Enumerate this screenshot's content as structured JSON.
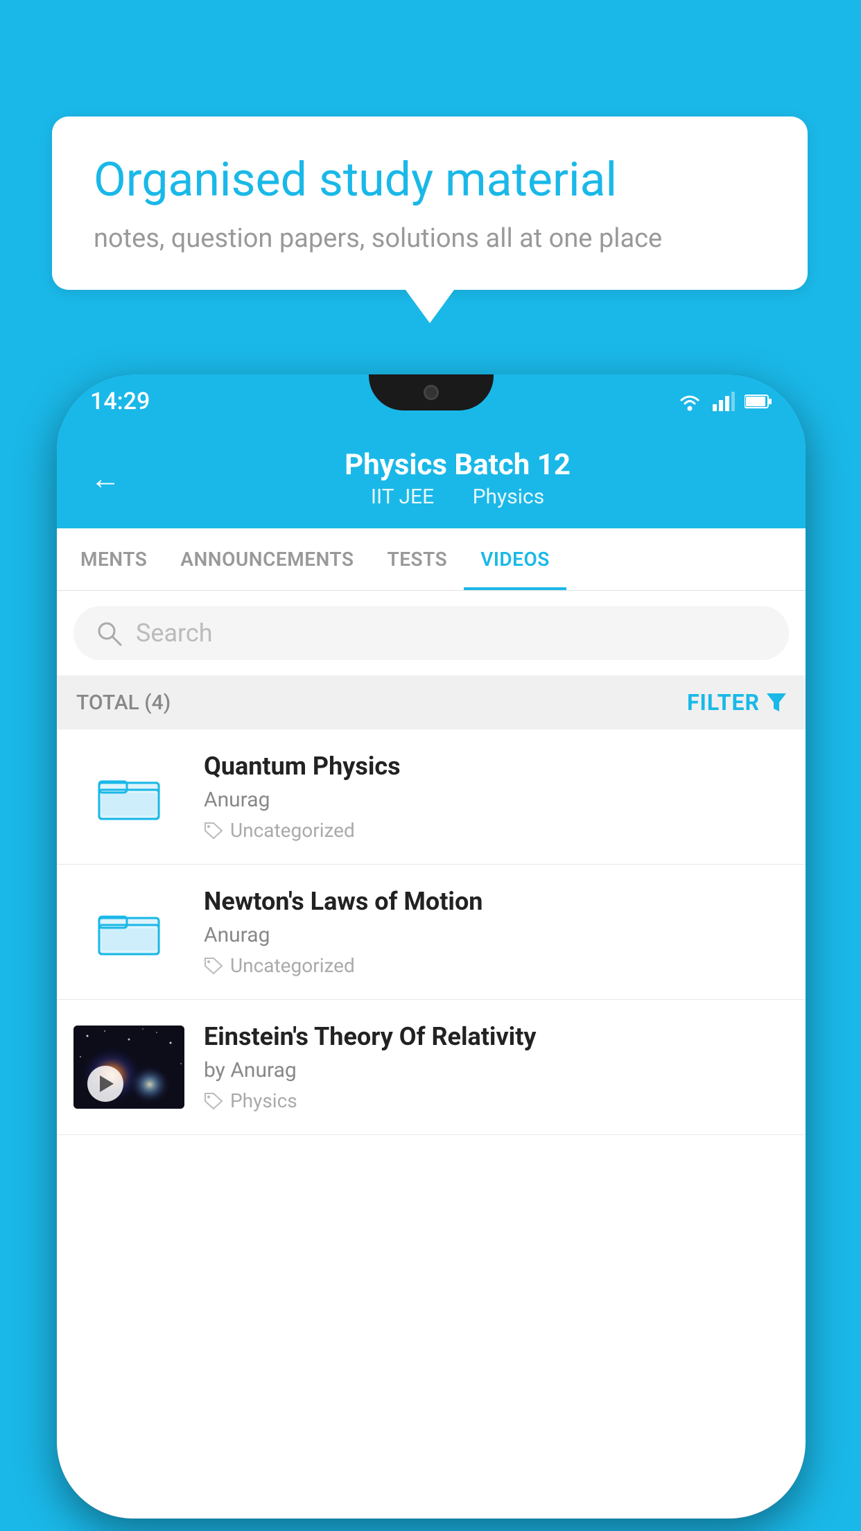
{
  "background_color": "#1ab8e8",
  "speech_bubble": {
    "title": "Organised study material",
    "subtitle": "notes, question papers, solutions all at one place"
  },
  "phone": {
    "status_bar": {
      "time": "14:29"
    },
    "header": {
      "back_label": "←",
      "title": "Physics Batch 12",
      "subtitle_part1": "IIT JEE",
      "subtitle_part2": "Physics"
    },
    "tabs": [
      {
        "label": "MENTS",
        "active": false
      },
      {
        "label": "ANNOUNCEMENTS",
        "active": false
      },
      {
        "label": "TESTS",
        "active": false
      },
      {
        "label": "VIDEOS",
        "active": true
      }
    ],
    "search": {
      "placeholder": "Search"
    },
    "filter_bar": {
      "total_label": "TOTAL (4)",
      "filter_label": "FILTER"
    },
    "video_items": [
      {
        "title": "Quantum Physics",
        "author": "Anurag",
        "tag": "Uncategorized",
        "has_thumbnail": false
      },
      {
        "title": "Newton's Laws of Motion",
        "author": "Anurag",
        "tag": "Uncategorized",
        "has_thumbnail": false
      },
      {
        "title": "Einstein's Theory Of Relativity",
        "author": "by Anurag",
        "tag": "Physics",
        "has_thumbnail": true
      }
    ]
  }
}
